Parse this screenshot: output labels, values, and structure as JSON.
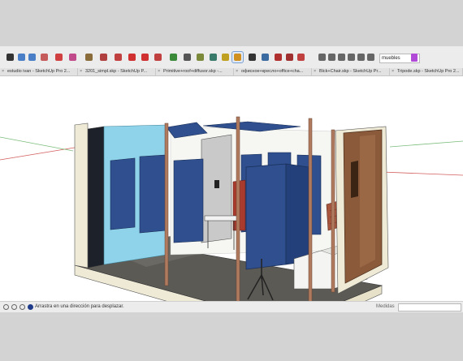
{
  "toolbar": {
    "tools": [
      {
        "icon": "select-arrow-icon",
        "color": "#333333"
      },
      {
        "icon": "undo-icon",
        "color": "#4a7fc7"
      },
      {
        "icon": "redo-icon",
        "color": "#4a7fc7"
      },
      {
        "icon": "eraser-icon",
        "color": "#c55a5a"
      },
      {
        "icon": "pencil-line-icon",
        "color": "#d04040"
      },
      {
        "icon": "arc-icon",
        "color": "#c04a8a"
      },
      {
        "icon": "rectangle-icon",
        "color": "#8a6b3a"
      },
      {
        "icon": "push-pull-icon",
        "color": "#b04040"
      },
      {
        "icon": "follow-me-icon",
        "color": "#c04040"
      },
      {
        "icon": "move-icon",
        "color": "#d03030"
      },
      {
        "icon": "rotate-icon",
        "color": "#d03030"
      },
      {
        "icon": "scale-icon",
        "color": "#c04040"
      },
      {
        "icon": "offset-icon",
        "color": "#3a8a3a"
      },
      {
        "icon": "tape-measure-icon",
        "color": "#555555"
      },
      {
        "icon": "text-icon",
        "color": "#7a8a3a"
      },
      {
        "icon": "paint-bucket-icon",
        "color": "#3a7a6a"
      },
      {
        "icon": "orbit-icon",
        "color": "#c0a020"
      },
      {
        "icon": "pan-hand-icon",
        "color": "#d09020"
      },
      {
        "icon": "zoom-icon",
        "color": "#333333"
      },
      {
        "icon": "zoom-extents-icon",
        "color": "#3a6aa0"
      },
      {
        "icon": "warehouse-icon",
        "color": "#b03030"
      },
      {
        "icon": "extension-icon",
        "color": "#a03030"
      },
      {
        "icon": "components-icon",
        "color": "#c04040"
      },
      {
        "icon": "iso-view-icon",
        "color": "#666666"
      },
      {
        "icon": "top-view-icon",
        "color": "#666666"
      },
      {
        "icon": "front-view-icon",
        "color": "#666666"
      },
      {
        "icon": "right-view-icon",
        "color": "#666666"
      },
      {
        "icon": "back-view-icon",
        "color": "#666666"
      },
      {
        "icon": "left-view-icon",
        "color": "#666666"
      }
    ],
    "search_value": "muebles"
  },
  "tabs": [
    {
      "label": "estudio ivan - SketchUp Pro 2..."
    },
    {
      "label": "3201_simpl.skp - SketchUp P..."
    },
    {
      "label": "Primitive+roof+diffusor.skp -..."
    },
    {
      "label": "офисное+кресло+office+cha..."
    },
    {
      "label": "Blck+Chair.skp - SketchUp Pr..."
    },
    {
      "label": "Tripode.skp - SketchUp Pro 2..."
    }
  ],
  "status": {
    "message": "Arrastra en una dirección para desplazar.",
    "measure_label": "Medidas",
    "measure_value": ""
  },
  "colors": {
    "panel_blue": "#2f4f8f",
    "panel_dark": "#1f3a73",
    "glass": "#8fd3ea",
    "floor": "#5c5a55",
    "wall_cream": "#eeead6",
    "wood": "#8b5a3b",
    "post": "#b07a5e"
  }
}
